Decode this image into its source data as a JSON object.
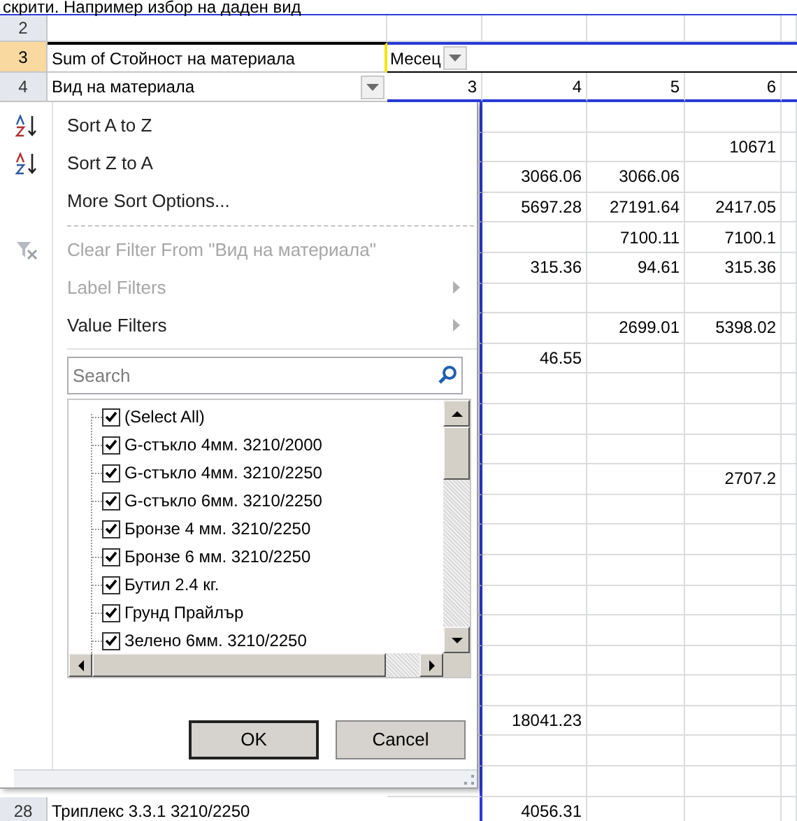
{
  "caption": "скрити. Например избор на даден вид",
  "header_rows": [
    {
      "row": "2",
      "selected": false
    },
    {
      "row": "3",
      "selected": true,
      "label": "Sum of Стойност на материала",
      "field": "Месец"
    },
    {
      "row": "4",
      "selected": false,
      "label": "Вид на материала",
      "months": [
        "3",
        "4",
        "5",
        "6"
      ]
    }
  ],
  "data_rows": [
    {},
    {
      "col_6": "10671"
    },
    {
      "col_4": "3066.06",
      "col_5": "3066.06"
    },
    {
      "col_4": "5697.28",
      "col_5": "27191.64",
      "col_6": "2417.05"
    },
    {
      "col_5": "7100.11",
      "col_6": "7100.1"
    },
    {
      "col_4": "315.36",
      "col_5": "94.61",
      "col_6": "315.36"
    },
    {},
    {
      "col_5": "2699.01",
      "col_6": "5398.02"
    },
    {
      "col_4": "46.55"
    },
    {},
    {},
    {},
    {
      "col_6": "2707.2"
    },
    {},
    {},
    {},
    {},
    {},
    {},
    {},
    {
      "col_4": "18041.23"
    },
    {},
    {}
  ],
  "last_row": {
    "row": "28",
    "selected": false,
    "label": "Триплекс 3.3.1 3210/2250",
    "col_4": "4056.31"
  },
  "filter_menu": {
    "items": [
      {
        "kind": "sort-asc",
        "label": "Sort A to Z",
        "disabled": false,
        "submenu": false
      },
      {
        "kind": "sort-desc",
        "label": "Sort Z to A",
        "disabled": false,
        "submenu": false
      },
      {
        "kind": "plain",
        "label": "More Sort Options...",
        "disabled": false,
        "submenu": false
      },
      {
        "kind": "separator"
      },
      {
        "kind": "clear-filter",
        "label": "Clear Filter From \"Вид на материала\"",
        "disabled": true,
        "submenu": false
      },
      {
        "kind": "plain",
        "label": "Label Filters",
        "disabled": true,
        "submenu": true
      },
      {
        "kind": "plain",
        "label": "Value Filters",
        "disabled": false,
        "submenu": true
      }
    ],
    "search": {
      "placeholder": "Search"
    },
    "values": [
      {
        "label": "(Select All)",
        "checked": true
      },
      {
        "label": "G-стъкло 4мм. 3210/2000",
        "checked": true
      },
      {
        "label": "G-стъкло 4мм. 3210/2250",
        "checked": true
      },
      {
        "label": "G-стъкло 6мм. 3210/2250",
        "checked": true
      },
      {
        "label": "Бронзе 4 мм. 3210/2250",
        "checked": true
      },
      {
        "label": "Бронзе 6 мм. 3210/2250",
        "checked": true
      },
      {
        "label": "Бутил 2.4 кг.",
        "checked": true
      },
      {
        "label": "Грунд Прайлър",
        "checked": true
      },
      {
        "label": "Зелено 6мм. 3210/2250",
        "checked": true
      }
    ],
    "buttons": [
      {
        "kind": "ok",
        "label": "OK"
      },
      {
        "kind": "cancel",
        "label": "Cancel"
      }
    ]
  }
}
